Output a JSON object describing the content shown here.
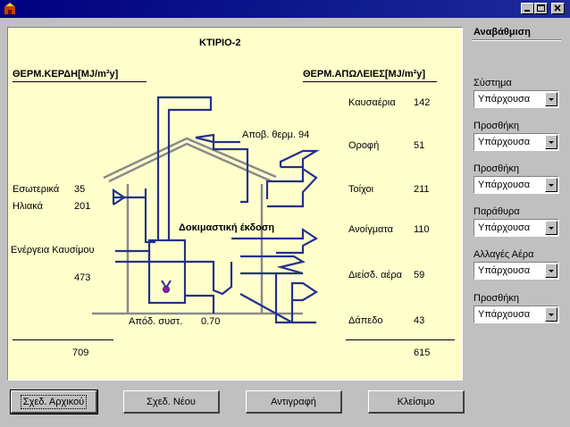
{
  "window": {
    "title": ""
  },
  "diagram": {
    "title": "ΚΤΙΡΙΟ-2",
    "gains_header": "ΘΕΡΜ.ΚΕΡΔΗ[MJ/m²y]",
    "losses_header": "ΘΕΡΜ.ΑΠΩΛΕΙΕΣ[MJ/m²y]",
    "gains": {
      "internal_label": "Εσωτερικά",
      "internal_value": "35",
      "solar_label": "Ηλιακά",
      "solar_value": "201",
      "fuel_label": "Ενέργεια Καυσίμου",
      "fuel_value": "473",
      "total": "709"
    },
    "losses": {
      "items": [
        {
          "label": "Καυσαέρια",
          "value": "142"
        },
        {
          "label": "Οροφή",
          "value": "51"
        },
        {
          "label": "Τοίχοι",
          "value": "211"
        },
        {
          "label": "Ανοίγματα",
          "value": "110"
        },
        {
          "label": "Διείσδ. αέρα",
          "value": "59"
        },
        {
          "label": "Δάπεδο",
          "value": "43"
        }
      ],
      "total": "615"
    },
    "recovery_text": "Αποβ. θερμ. 94",
    "system_eff_label": "Απόδ. συστ.",
    "system_eff_value": "0.70",
    "watermark": "Δοκιμαστική έκδοση"
  },
  "sidebar": {
    "title": "Αναβάθμιση",
    "options": [
      {
        "label": "Σύστημα",
        "value": "Υπάρχουσα"
      },
      {
        "label": "Προσθήκη",
        "value": "Υπάρχουσα"
      },
      {
        "label": "Προσθήκη",
        "value": "Υπάρχουσα"
      },
      {
        "label": "Παράθυρα",
        "value": "Υπάρχουσα"
      },
      {
        "label": "Αλλαγές Αέρα",
        "value": "Υπάρχουσα"
      },
      {
        "label": "Προσθήκη",
        "value": "Υπάρχουσα"
      }
    ]
  },
  "buttons": {
    "initial": "Σχεδ. Αρχικού",
    "new": "Σχεδ. Νέου",
    "copy": "Αντιγραφή",
    "close": "Κλείσιμο"
  },
  "colors": {
    "panel_bg": "#ffffcc",
    "flow_line": "#23318c",
    "house_line": "#808080",
    "titlebar": "#00007f"
  }
}
